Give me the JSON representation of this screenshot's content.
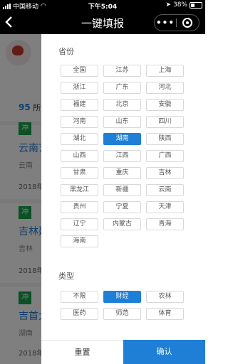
{
  "status": {
    "carrier": "中国移动",
    "time": "下午5:04",
    "battery": "38%",
    "battery_level": 0.38
  },
  "nav": {
    "title": "一键填报",
    "menu_glyph": "•••"
  },
  "background": {
    "count_number": "95",
    "count_text": "所大",
    "cards": [
      {
        "tag": "冲",
        "name": "云南艺",
        "location": "云南",
        "year": "2018年"
      },
      {
        "tag": "冲",
        "name": "吉林建",
        "location": "吉林",
        "year": "2018年"
      },
      {
        "tag": "冲",
        "name": "吉首大",
        "location": "湖南",
        "year": "2018年"
      }
    ]
  },
  "filter": {
    "province_title": "省份",
    "provinces": [
      "全国",
      "江苏",
      "上海",
      "浙江",
      "广东",
      "河北",
      "福建",
      "北京",
      "安徽",
      "河南",
      "山东",
      "四川",
      "湖北",
      "湖南",
      "陕西",
      "山西",
      "江西",
      "广西",
      "甘肃",
      "重庆",
      "吉林",
      "黑龙江",
      "新疆",
      "云南",
      "贵州",
      "宁夏",
      "天津",
      "辽宁",
      "内蒙古",
      "青海",
      "海南"
    ],
    "selected_province": "湖南",
    "type_title": "类型",
    "types": [
      "不限",
      "财经",
      "农林",
      "医药",
      "师范",
      "体育"
    ],
    "selected_type": "财经",
    "reset_label": "重置",
    "confirm_label": "确认"
  },
  "colors": {
    "accent": "#1f7fd6",
    "tag_green": "#17a24b"
  }
}
